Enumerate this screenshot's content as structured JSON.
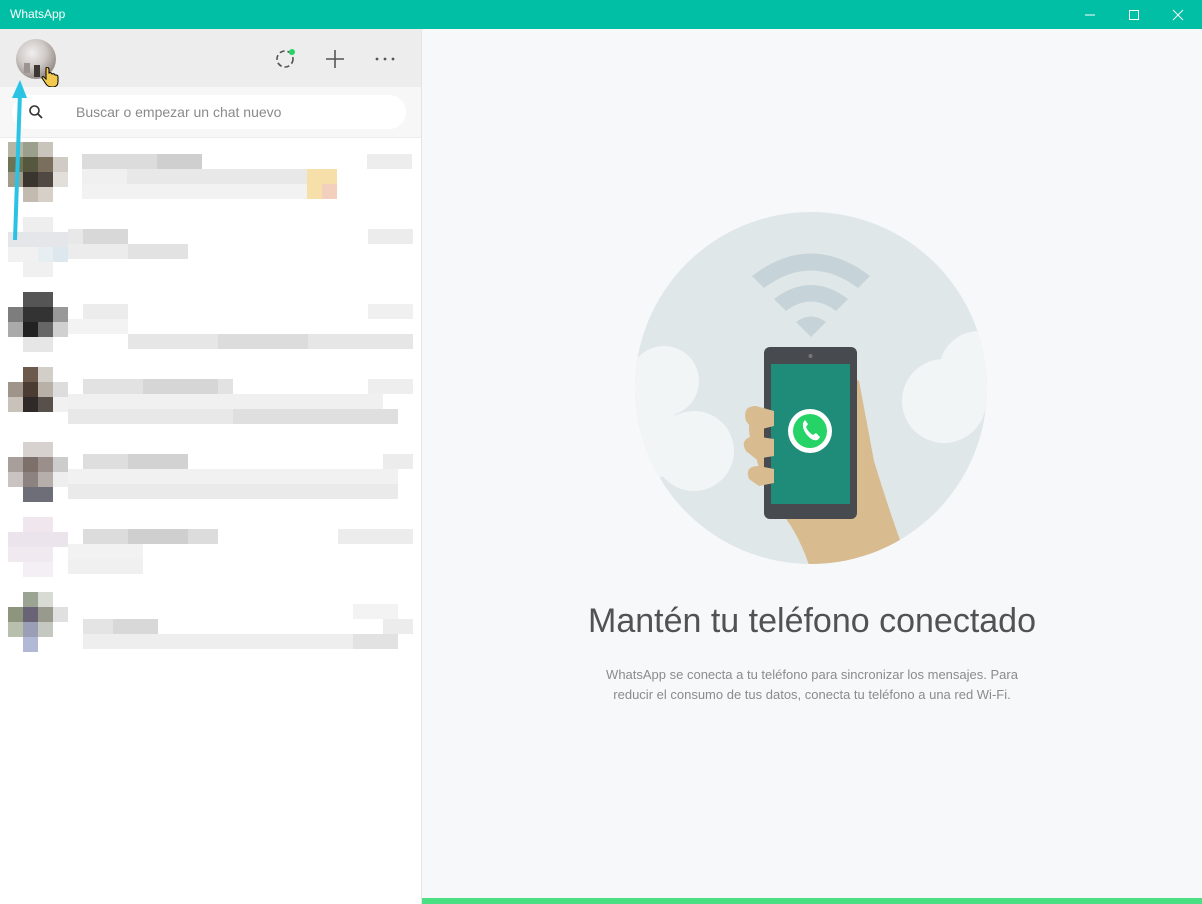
{
  "window": {
    "title": "WhatsApp",
    "controls": [
      "minimize-icon",
      "maximize-icon",
      "close-icon"
    ]
  },
  "sidebar": {
    "header_icons": [
      "status-icon",
      "new-chat-icon",
      "menu-icon"
    ],
    "search": {
      "placeholder": "Buscar o empezar un chat nuevo",
      "value": ""
    }
  },
  "main": {
    "title": "Mantén tu teléfono conectado",
    "description": "WhatsApp se conecta a tu teléfono para sincronizar los mensajes. Para reducir el consumo de tus datos, conecta tu teléfono a una red Wi-Fi."
  },
  "colors": {
    "titlebar": "#00bfa5",
    "accent_bar": "#4adf83",
    "status_dot": "#25d366",
    "arrow": "#2bc3e4"
  }
}
